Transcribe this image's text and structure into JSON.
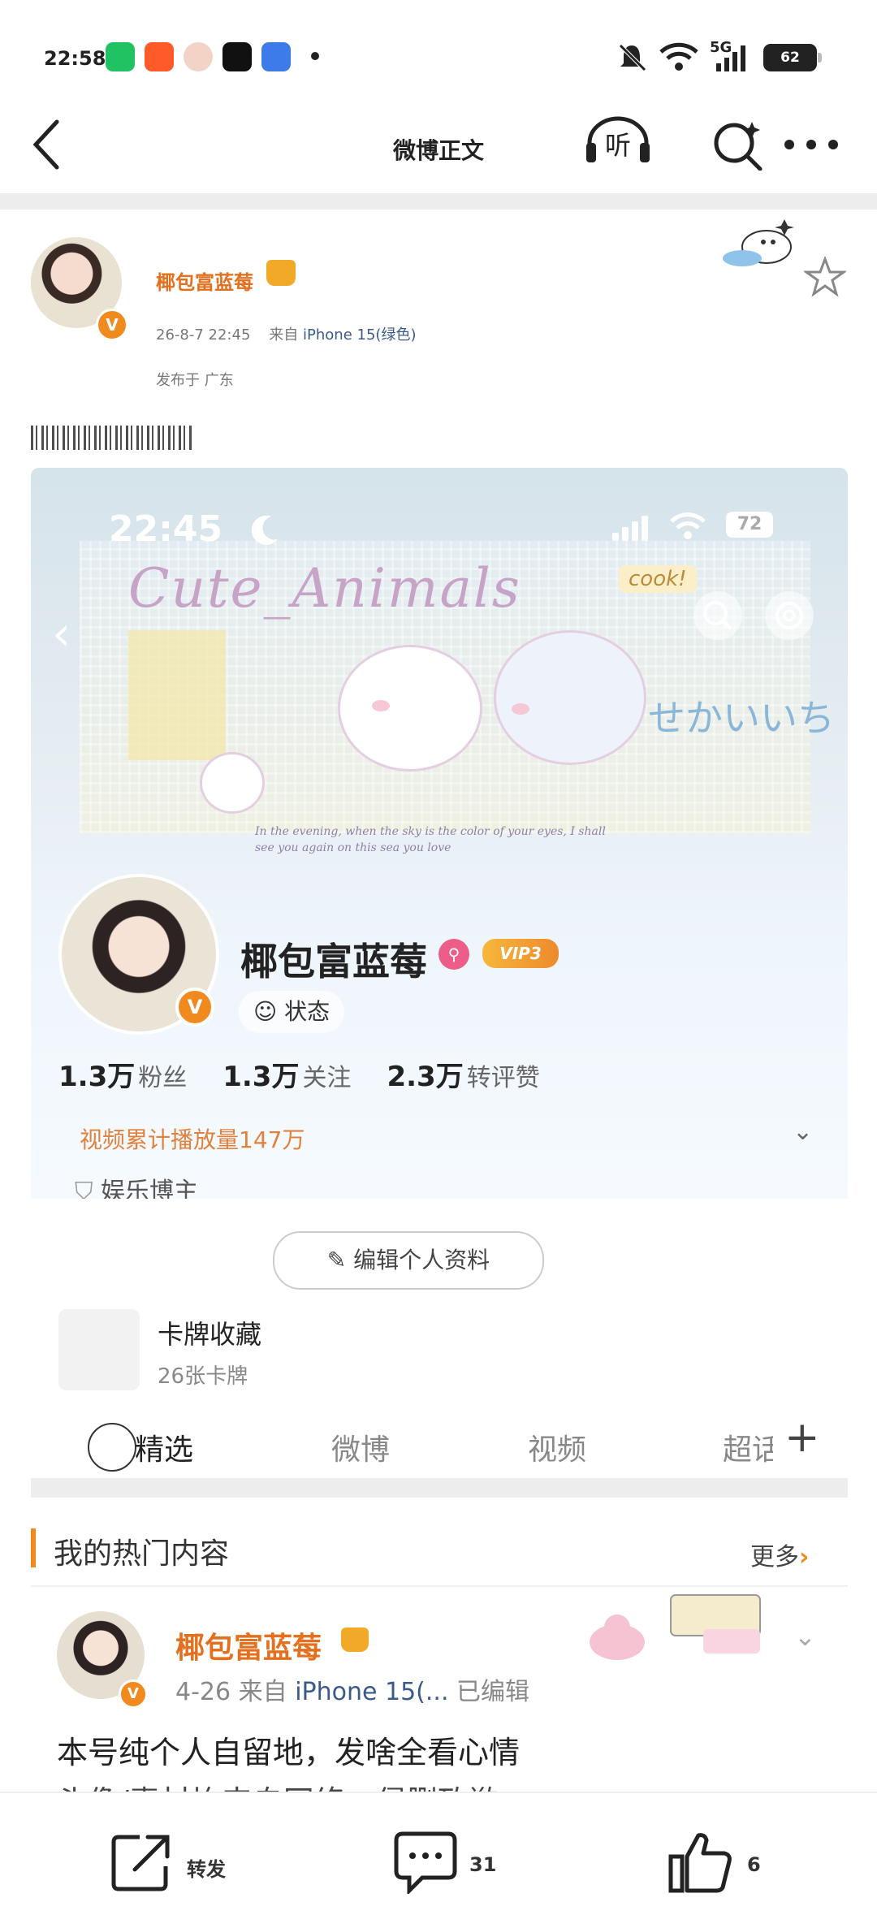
{
  "status_bar": {
    "time": "22:58",
    "network": "5G",
    "battery": "62",
    "app_icons": [
      {
        "name": "wechat",
        "color": "#21c262"
      },
      {
        "name": "app-orange",
        "color": "#ff5a2a"
      },
      {
        "name": "avatar-app",
        "color": "#f2d3c6"
      },
      {
        "name": "tiktok",
        "color": "#111111"
      },
      {
        "name": "tieba",
        "color": "#3d7bea"
      }
    ]
  },
  "nav": {
    "title": "微博正文",
    "listen_label": "听"
  },
  "post": {
    "author": "椰包富蓝莓",
    "time": "26-8-7 22:45",
    "source_prefix": "来自",
    "source_device": "iPhone 15(绿色)",
    "location": "发布于 广东",
    "verified_badge": "V"
  },
  "embedded": {
    "status_time": "22:45",
    "battery": "72",
    "banner_title": "Cute_Animals",
    "banner_jp": "せかいいち",
    "banner_cook": "cook!",
    "banner_english": "In the evening, when the sky is the color of your eyes, I shall see you again on this sea you love",
    "profile_name": "椰包富蓝莓",
    "vip_label": "VIP3",
    "status_button": "状态",
    "stats": [
      {
        "value": "1.3万",
        "label": "粉丝"
      },
      {
        "value": "1.3万",
        "label": "关注"
      },
      {
        "value": "2.3万",
        "label": "转评赞"
      }
    ],
    "views_text": "视频累计播放量147万",
    "tag_text": "娱乐博主",
    "edit_button": "编辑个人资料",
    "card_title": "卡牌收藏",
    "card_sub": "26张卡牌",
    "tabs": [
      "精选",
      "微博",
      "视频",
      "超话"
    ]
  },
  "hot_section": {
    "title": "我的热门内容",
    "more": "更多",
    "item": {
      "author": "椰包富蓝莓",
      "date": "4-26",
      "source_prefix": "来自",
      "source_device": "iPhone 15(...",
      "edited": "已编辑",
      "text_line1": "本号纯个人自留地，发啥全看心情",
      "text_line2": "头像/素材均来自网络，侵删致歉"
    }
  },
  "bottom_bar": {
    "repost_label": "转发",
    "comment_count": "31",
    "like_count": "6"
  },
  "colors": {
    "accent_orange": "#f08a1f",
    "name_orange": "#e3701e",
    "link_blue": "#3b5a8a"
  }
}
